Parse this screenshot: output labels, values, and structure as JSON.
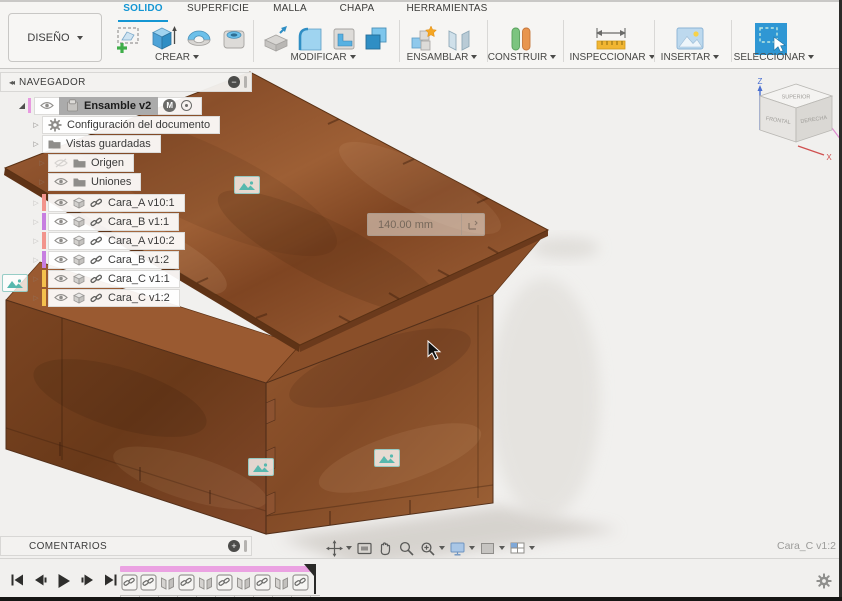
{
  "ribbon": {
    "design_button": "DISEÑO",
    "tabs": [
      {
        "label": "SOLIDO",
        "active": true
      },
      {
        "label": "SUPERFICIE",
        "active": false
      },
      {
        "label": "MALLA",
        "active": false
      },
      {
        "label": "CHAPA",
        "active": false
      },
      {
        "label": "HERRAMIENTAS",
        "active": false
      }
    ],
    "groups": [
      {
        "label": "CREAR"
      },
      {
        "label": "MODIFICAR"
      },
      {
        "label": "ENSAMBLAR"
      },
      {
        "label": "CONSTRUIR"
      },
      {
        "label": "INSPECCIONAR"
      },
      {
        "label": "INSERTAR"
      },
      {
        "label": "SELECCIONAR"
      }
    ]
  },
  "navigator": {
    "title": "NAVEGADOR",
    "root": {
      "label": "Ensamble v2",
      "badge": "M"
    },
    "items": [
      {
        "label": "Configuración del documento"
      },
      {
        "label": "Vistas guardadas"
      },
      {
        "label": "Origen"
      },
      {
        "label": "Uniones"
      }
    ],
    "components": [
      {
        "label": "Cara_A v10:1",
        "color": "#f2948c"
      },
      {
        "label": "Cara_B v1:1",
        "color": "#c77ee0"
      },
      {
        "label": "Cara_A v10:2",
        "color": "#f2948c"
      },
      {
        "label": "Cara_B v1:2",
        "color": "#c77ee0"
      },
      {
        "label": "Cara_C v1:1",
        "color": "#f4c14e"
      },
      {
        "label": "Cara_C v1:2",
        "color": "#f4c14e"
      }
    ]
  },
  "viewport": {
    "dimension_value": "140.00 mm",
    "hover_label": "Cara_C v1:2",
    "viewcube": {
      "top": "SUPERIOR",
      "front": "FRONTAL",
      "right": "DERECHA",
      "axis_z": "Z",
      "axis_x": "X"
    }
  },
  "comments": {
    "title": "COMENTARIOS"
  },
  "timeline": {
    "bar_color": "#eba2e2",
    "features": [
      "component-link",
      "component-link",
      "joint",
      "component-link",
      "joint",
      "component-link",
      "joint",
      "component-link",
      "joint",
      "component-link"
    ]
  },
  "colors": {
    "accent_blue": "#1496d3",
    "selection_pink": "#e79ae0",
    "wood_mid": "#8a4f2a"
  }
}
